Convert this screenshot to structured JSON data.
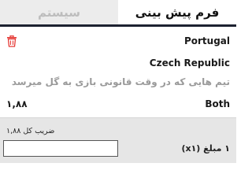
{
  "tabs": [
    {
      "label": "فرم پیش بینی",
      "active": true
    },
    {
      "label": "سیستم",
      "active": false
    }
  ],
  "bet": {
    "delete_icon": "trash-icon",
    "team1": "Portugal",
    "team2": "Czech Republic",
    "market": "تیم هایی که در وقت قانونی بازی به گل میرسد",
    "pick": "Both",
    "odds": "۱,۸۸"
  },
  "slip": {
    "total_odds_label": "ضریب کل ۱,۸۸",
    "stake_label": "۱ مبلغ (x۱)",
    "stake_value": ""
  },
  "colors": {
    "accent": "#e53935",
    "tab_underline": "#1d2231",
    "footer_bg": "#e6e6e6"
  }
}
